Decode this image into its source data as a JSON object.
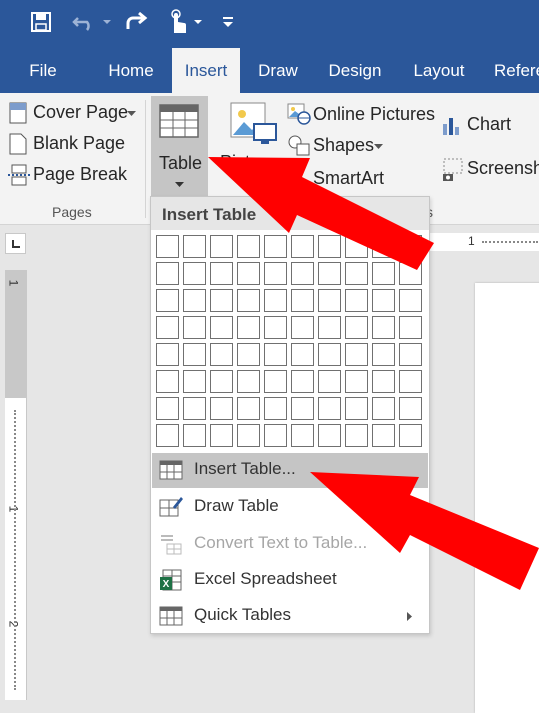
{
  "ribbon_tabs": [
    "File",
    "Home",
    "Insert",
    "Draw",
    "Design",
    "Layout",
    "Refere"
  ],
  "active_tab": "Insert",
  "pages_group": {
    "items": [
      "Cover Page",
      "Blank Page",
      "Page Break"
    ],
    "label": "Pages"
  },
  "table_button": {
    "label": "Table"
  },
  "illustrations": {
    "pictures": "Pictures",
    "online_pictures": "Online Pictures",
    "shapes": "Shapes",
    "smartart": "SmartArt",
    "chart": "Chart",
    "screenshot": "Screensho",
    "group_label": "s"
  },
  "dropdown": {
    "title": "Insert Table",
    "grid": {
      "columns": 10,
      "rows": 8
    },
    "items": [
      {
        "label": "Insert Table...",
        "state": "highlighted"
      },
      {
        "label": "Draw Table",
        "state": "enabled"
      },
      {
        "label": "Convert Text to Table...",
        "state": "disabled"
      },
      {
        "label": "Excel Spreadsheet",
        "state": "enabled"
      },
      {
        "label": "Quick Tables",
        "state": "submenu"
      }
    ]
  },
  "rulers": {
    "horizontal_mark": "1",
    "vertical_marks": [
      "1",
      "1",
      "2"
    ]
  },
  "colors": {
    "title_bar": "#2b579a",
    "ribbon": "#f3f3f3",
    "annotation_arrow": "#ff0000",
    "excel_green": "#1e7145"
  },
  "icons": [
    "save-icon",
    "undo-icon",
    "redo-icon",
    "touch-mode-icon",
    "customize-qat-icon",
    "cover-page-icon",
    "blank-page-icon",
    "page-break-icon",
    "table-icon",
    "pictures-icon",
    "online-pictures-icon",
    "shapes-icon",
    "chart-icon",
    "screenshot-icon",
    "insert-table-icon",
    "draw-table-icon",
    "convert-text-icon",
    "excel-icon",
    "quick-tables-icon"
  ]
}
